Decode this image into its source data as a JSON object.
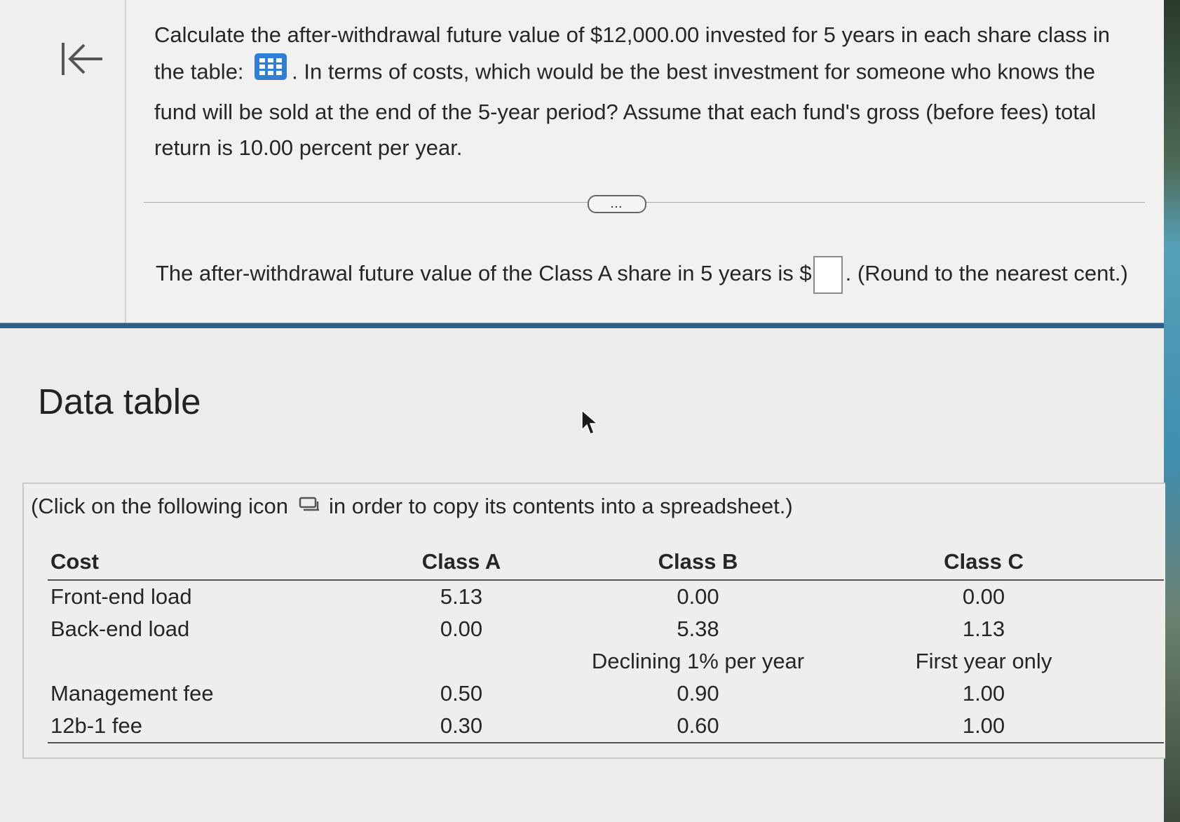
{
  "question": {
    "text_before_icon": "Calculate the after-withdrawal future value of $12,000.00 invested for 5 years in each share class in the table: ",
    "text_after_icon": ". In terms of costs, which would be the best investment for someone who knows the fund will be sold at the end of the 5-year period? Assume that each fund's gross (before fees) total return is 10.00 percent per year."
  },
  "more_button": "...",
  "answer": {
    "before": "The after-withdrawal future value of the Class A share in 5 years is $",
    "after": ". (Round to the nearest cent.)"
  },
  "data_table": {
    "title": "Data table",
    "copy_before": "(Click on the following icon",
    "copy_after": "in order to copy its contents into a spreadsheet.)",
    "headers": [
      "Cost",
      "Class A",
      "Class B",
      "Class C"
    ],
    "rows": [
      [
        "Front-end load",
        "5.13",
        "0.00",
        "0.00"
      ],
      [
        "Back-end load",
        "0.00",
        "5.38",
        "1.13"
      ],
      [
        "",
        "",
        "Declining 1% per year",
        "First year only"
      ],
      [
        "Management fee",
        "0.50",
        "0.90",
        "1.00"
      ],
      [
        "12b-1 fee",
        "0.30",
        "0.60",
        "1.00"
      ]
    ]
  },
  "colors": {
    "accent_blue": "#2f7fd6",
    "rule_blue": "#2f5f86"
  },
  "icons": [
    "back-to-start-icon",
    "grid-table-icon",
    "copy-icon",
    "mouse-pointer-icon"
  ]
}
